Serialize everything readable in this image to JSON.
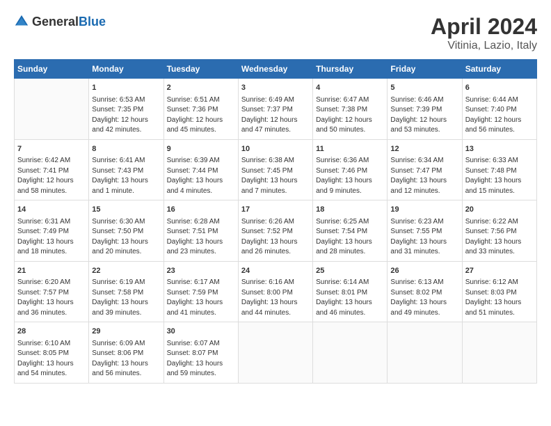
{
  "header": {
    "logo_general": "General",
    "logo_blue": "Blue",
    "month": "April 2024",
    "location": "Vitinia, Lazio, Italy"
  },
  "columns": [
    "Sunday",
    "Monday",
    "Tuesday",
    "Wednesday",
    "Thursday",
    "Friday",
    "Saturday"
  ],
  "weeks": [
    [
      {
        "day": "",
        "sunrise": "",
        "sunset": "",
        "daylight": ""
      },
      {
        "day": "1",
        "sunrise": "Sunrise: 6:53 AM",
        "sunset": "Sunset: 7:35 PM",
        "daylight": "Daylight: 12 hours and 42 minutes."
      },
      {
        "day": "2",
        "sunrise": "Sunrise: 6:51 AM",
        "sunset": "Sunset: 7:36 PM",
        "daylight": "Daylight: 12 hours and 45 minutes."
      },
      {
        "day": "3",
        "sunrise": "Sunrise: 6:49 AM",
        "sunset": "Sunset: 7:37 PM",
        "daylight": "Daylight: 12 hours and 47 minutes."
      },
      {
        "day": "4",
        "sunrise": "Sunrise: 6:47 AM",
        "sunset": "Sunset: 7:38 PM",
        "daylight": "Daylight: 12 hours and 50 minutes."
      },
      {
        "day": "5",
        "sunrise": "Sunrise: 6:46 AM",
        "sunset": "Sunset: 7:39 PM",
        "daylight": "Daylight: 12 hours and 53 minutes."
      },
      {
        "day": "6",
        "sunrise": "Sunrise: 6:44 AM",
        "sunset": "Sunset: 7:40 PM",
        "daylight": "Daylight: 12 hours and 56 minutes."
      }
    ],
    [
      {
        "day": "7",
        "sunrise": "Sunrise: 6:42 AM",
        "sunset": "Sunset: 7:41 PM",
        "daylight": "Daylight: 12 hours and 58 minutes."
      },
      {
        "day": "8",
        "sunrise": "Sunrise: 6:41 AM",
        "sunset": "Sunset: 7:43 PM",
        "daylight": "Daylight: 13 hours and 1 minute."
      },
      {
        "day": "9",
        "sunrise": "Sunrise: 6:39 AM",
        "sunset": "Sunset: 7:44 PM",
        "daylight": "Daylight: 13 hours and 4 minutes."
      },
      {
        "day": "10",
        "sunrise": "Sunrise: 6:38 AM",
        "sunset": "Sunset: 7:45 PM",
        "daylight": "Daylight: 13 hours and 7 minutes."
      },
      {
        "day": "11",
        "sunrise": "Sunrise: 6:36 AM",
        "sunset": "Sunset: 7:46 PM",
        "daylight": "Daylight: 13 hours and 9 minutes."
      },
      {
        "day": "12",
        "sunrise": "Sunrise: 6:34 AM",
        "sunset": "Sunset: 7:47 PM",
        "daylight": "Daylight: 13 hours and 12 minutes."
      },
      {
        "day": "13",
        "sunrise": "Sunrise: 6:33 AM",
        "sunset": "Sunset: 7:48 PM",
        "daylight": "Daylight: 13 hours and 15 minutes."
      }
    ],
    [
      {
        "day": "14",
        "sunrise": "Sunrise: 6:31 AM",
        "sunset": "Sunset: 7:49 PM",
        "daylight": "Daylight: 13 hours and 18 minutes."
      },
      {
        "day": "15",
        "sunrise": "Sunrise: 6:30 AM",
        "sunset": "Sunset: 7:50 PM",
        "daylight": "Daylight: 13 hours and 20 minutes."
      },
      {
        "day": "16",
        "sunrise": "Sunrise: 6:28 AM",
        "sunset": "Sunset: 7:51 PM",
        "daylight": "Daylight: 13 hours and 23 minutes."
      },
      {
        "day": "17",
        "sunrise": "Sunrise: 6:26 AM",
        "sunset": "Sunset: 7:52 PM",
        "daylight": "Daylight: 13 hours and 26 minutes."
      },
      {
        "day": "18",
        "sunrise": "Sunrise: 6:25 AM",
        "sunset": "Sunset: 7:54 PM",
        "daylight": "Daylight: 13 hours and 28 minutes."
      },
      {
        "day": "19",
        "sunrise": "Sunrise: 6:23 AM",
        "sunset": "Sunset: 7:55 PM",
        "daylight": "Daylight: 13 hours and 31 minutes."
      },
      {
        "day": "20",
        "sunrise": "Sunrise: 6:22 AM",
        "sunset": "Sunset: 7:56 PM",
        "daylight": "Daylight: 13 hours and 33 minutes."
      }
    ],
    [
      {
        "day": "21",
        "sunrise": "Sunrise: 6:20 AM",
        "sunset": "Sunset: 7:57 PM",
        "daylight": "Daylight: 13 hours and 36 minutes."
      },
      {
        "day": "22",
        "sunrise": "Sunrise: 6:19 AM",
        "sunset": "Sunset: 7:58 PM",
        "daylight": "Daylight: 13 hours and 39 minutes."
      },
      {
        "day": "23",
        "sunrise": "Sunrise: 6:17 AM",
        "sunset": "Sunset: 7:59 PM",
        "daylight": "Daylight: 13 hours and 41 minutes."
      },
      {
        "day": "24",
        "sunrise": "Sunrise: 6:16 AM",
        "sunset": "Sunset: 8:00 PM",
        "daylight": "Daylight: 13 hours and 44 minutes."
      },
      {
        "day": "25",
        "sunrise": "Sunrise: 6:14 AM",
        "sunset": "Sunset: 8:01 PM",
        "daylight": "Daylight: 13 hours and 46 minutes."
      },
      {
        "day": "26",
        "sunrise": "Sunrise: 6:13 AM",
        "sunset": "Sunset: 8:02 PM",
        "daylight": "Daylight: 13 hours and 49 minutes."
      },
      {
        "day": "27",
        "sunrise": "Sunrise: 6:12 AM",
        "sunset": "Sunset: 8:03 PM",
        "daylight": "Daylight: 13 hours and 51 minutes."
      }
    ],
    [
      {
        "day": "28",
        "sunrise": "Sunrise: 6:10 AM",
        "sunset": "Sunset: 8:05 PM",
        "daylight": "Daylight: 13 hours and 54 minutes."
      },
      {
        "day": "29",
        "sunrise": "Sunrise: 6:09 AM",
        "sunset": "Sunset: 8:06 PM",
        "daylight": "Daylight: 13 hours and 56 minutes."
      },
      {
        "day": "30",
        "sunrise": "Sunrise: 6:07 AM",
        "sunset": "Sunset: 8:07 PM",
        "daylight": "Daylight: 13 hours and 59 minutes."
      },
      {
        "day": "",
        "sunrise": "",
        "sunset": "",
        "daylight": ""
      },
      {
        "day": "",
        "sunrise": "",
        "sunset": "",
        "daylight": ""
      },
      {
        "day": "",
        "sunrise": "",
        "sunset": "",
        "daylight": ""
      },
      {
        "day": "",
        "sunrise": "",
        "sunset": "",
        "daylight": ""
      }
    ]
  ]
}
